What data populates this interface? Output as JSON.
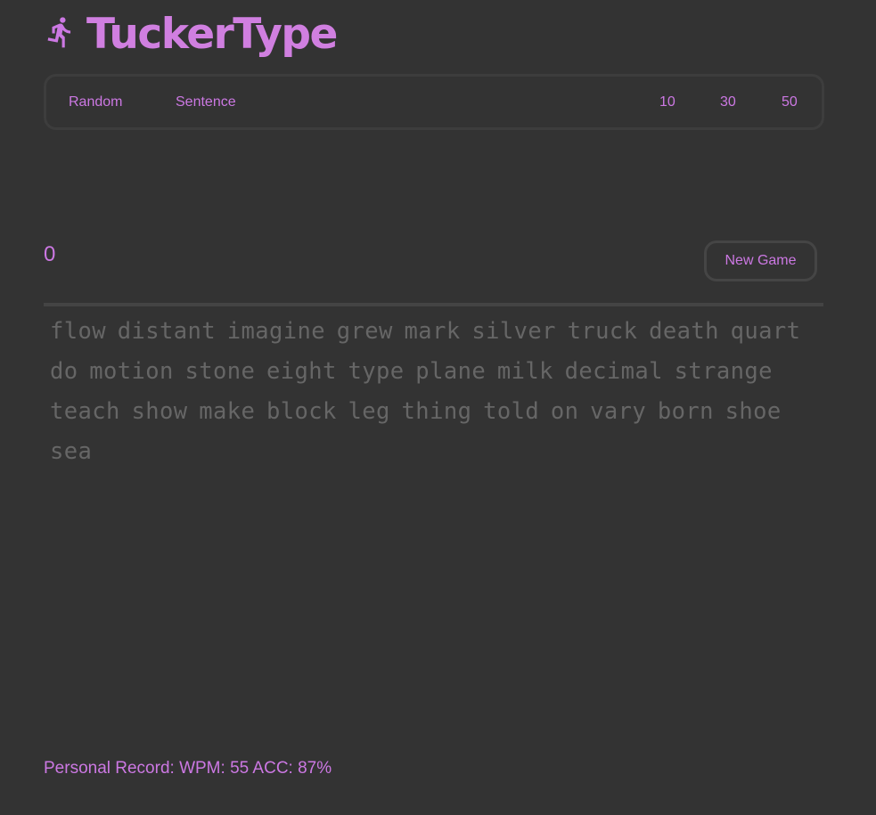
{
  "app": {
    "title": "TuckerType",
    "logo_icon": "running-person-icon",
    "accent_color": "#cc78e3",
    "background_color": "#333333"
  },
  "mode_bar": {
    "random_label": "Random",
    "sentence_label": "Sentence",
    "count_options": [
      "10",
      "30",
      "50"
    ]
  },
  "game": {
    "counter": "0",
    "new_game_label": "New Game",
    "words": "flow distant imagine grew mark silver truck death quart do motion stone eight type plane milk decimal strange teach show make block leg thing told on vary born shoe sea"
  },
  "footer": {
    "personal_record": "Personal Record: WPM: 55 ACC: 87%"
  }
}
